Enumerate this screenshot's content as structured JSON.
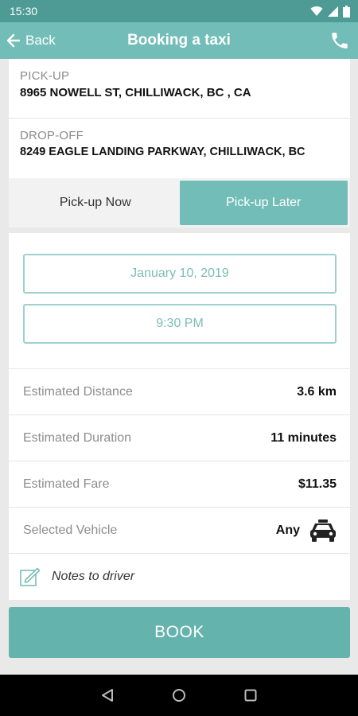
{
  "status_bar": {
    "time": "15:30"
  },
  "app_bar": {
    "back_label": "Back",
    "title": "Booking a taxi",
    "phone_icon": "phone-icon"
  },
  "pickup": {
    "label": "PICK-UP",
    "address": "8965 NOWELL ST, CHILLIWACK, BC , CA"
  },
  "dropoff": {
    "label": "DROP-OFF",
    "address": "8249 EAGLE LANDING PARKWAY, CHILLIWACK, BC"
  },
  "timing": {
    "options": [
      "Pick-up Now",
      "Pick-up Later"
    ],
    "selected": "Pick-up Later"
  },
  "schedule": {
    "date": "January 10, 2019",
    "time": "9:30 PM"
  },
  "estimates": {
    "distance_label": "Estimated Distance",
    "distance_value": "3.6 km",
    "duration_label": "Estimated Duration",
    "duration_value": "11 minutes",
    "fare_label": "Estimated Fare",
    "fare_value": "$11.35",
    "vehicle_label": "Selected Vehicle",
    "vehicle_value": "Any"
  },
  "notes": {
    "label": "Notes to driver"
  },
  "book_button": {
    "label": "BOOK"
  },
  "colors": {
    "primary": "#72bdb7",
    "status_bar": "#4e9b96",
    "book_button": "#64b3ad",
    "field_border": "#9fd0cc"
  }
}
